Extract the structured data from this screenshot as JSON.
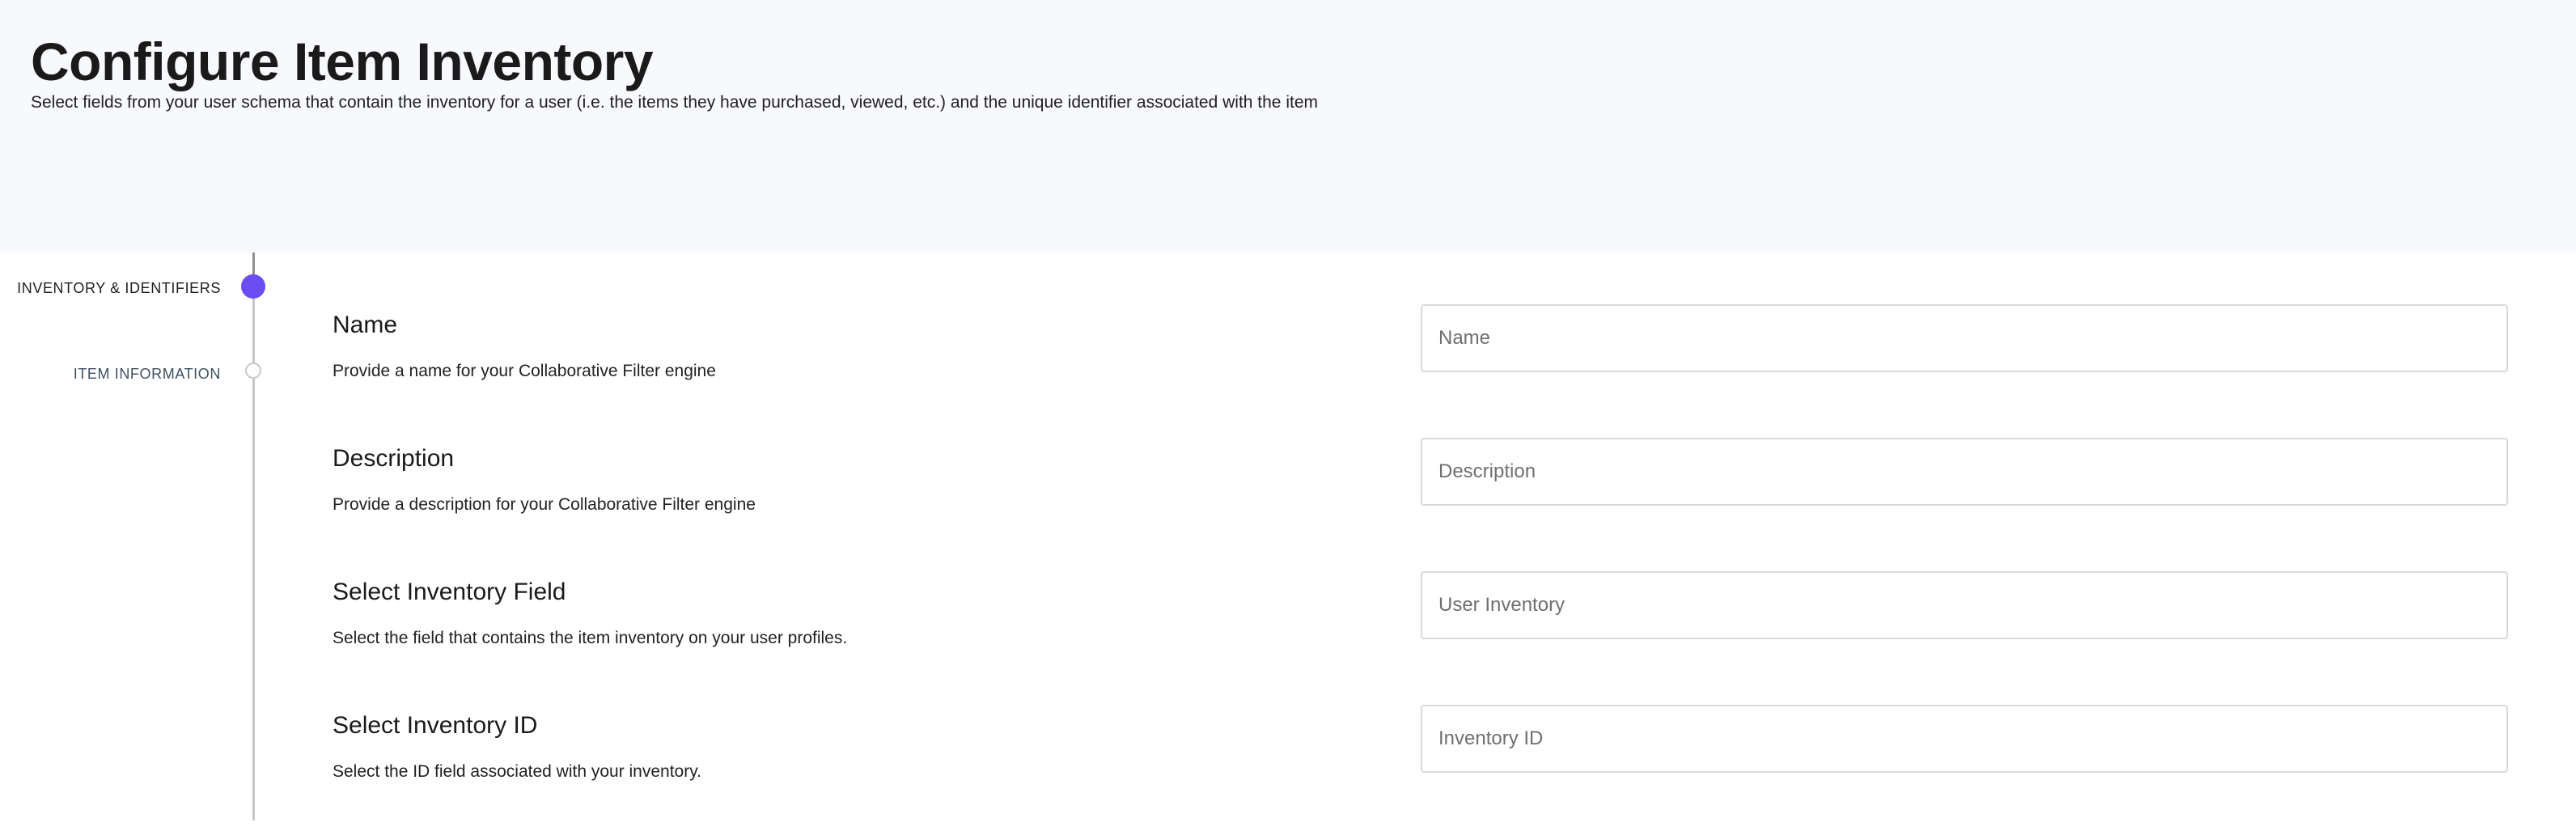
{
  "header": {
    "title": "Configure Item Inventory",
    "subtitle": "Select fields from your user schema that contain the inventory for a user (i.e. the items they have purchased, viewed, etc.) and the unique identifier associated with the item"
  },
  "stepper": {
    "steps": [
      {
        "label": "INVENTORY & IDENTIFIERS",
        "state": "active"
      },
      {
        "label": "ITEM INFORMATION",
        "state": "inactive"
      }
    ],
    "active_color": "#6c4df2"
  },
  "fields": [
    {
      "title": "Name",
      "description": "Provide a name for your Collaborative Filter engine",
      "placeholder": "Name",
      "value": ""
    },
    {
      "title": "Description",
      "description": "Provide a description for your Collaborative Filter engine",
      "placeholder": "Description",
      "value": ""
    },
    {
      "title": "Select Inventory Field",
      "description": "Select the field that contains the item inventory on your user profiles.",
      "placeholder": "User Inventory",
      "value": ""
    },
    {
      "title": "Select Inventory ID",
      "description": "Select the ID field associated with your inventory.",
      "placeholder": "Inventory ID",
      "value": ""
    }
  ]
}
